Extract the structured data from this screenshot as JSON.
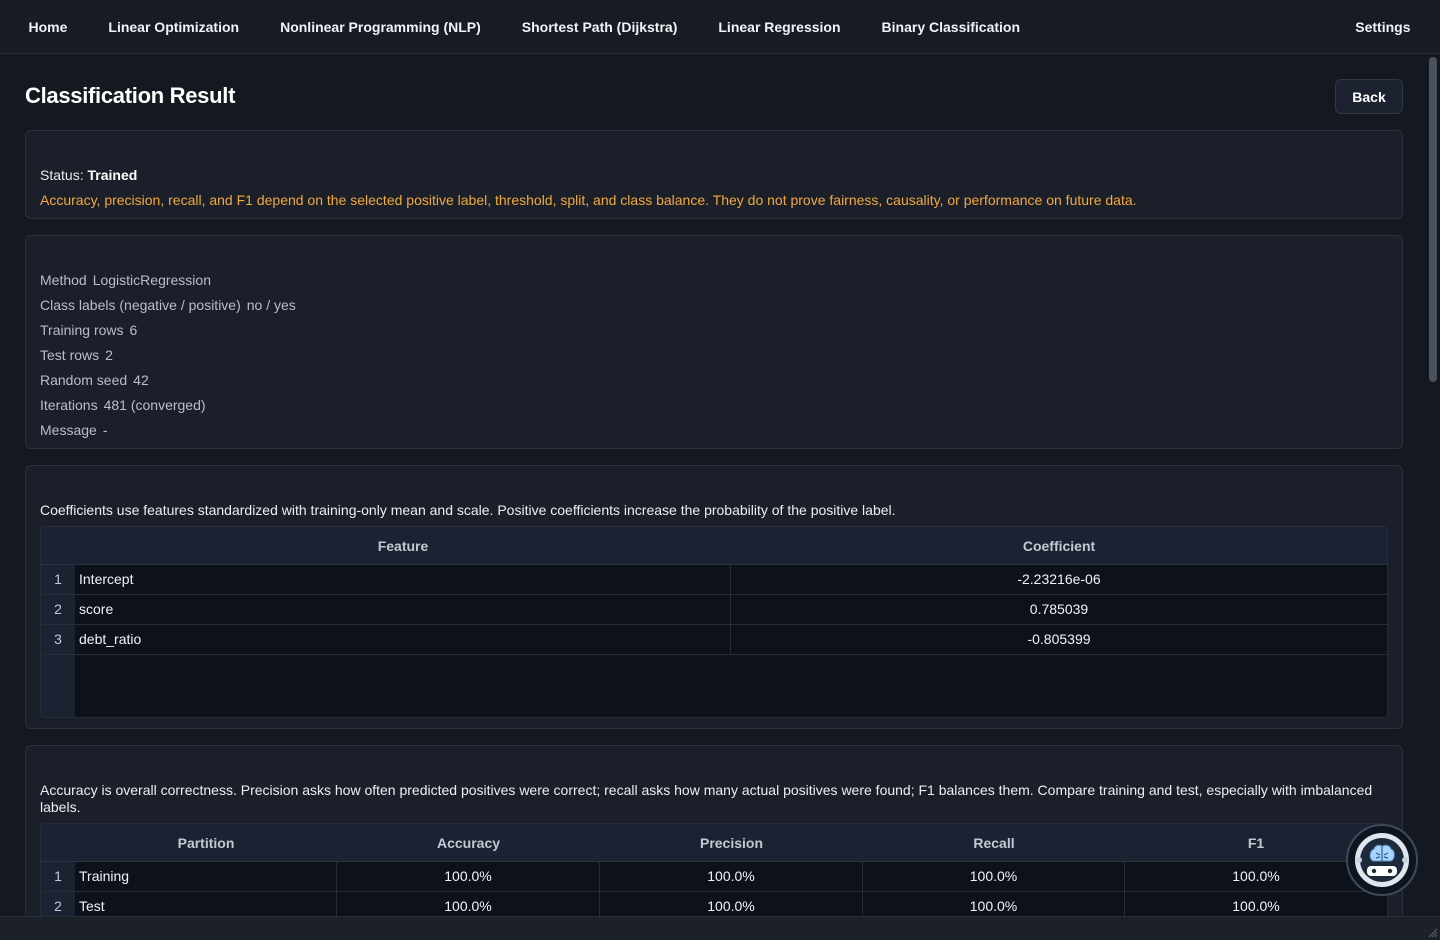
{
  "nav": {
    "items": [
      {
        "label": "Home"
      },
      {
        "label": "Linear Optimization"
      },
      {
        "label": "Nonlinear Programming (NLP)"
      },
      {
        "label": "Shortest Path (Dijkstra)"
      },
      {
        "label": "Linear Regression"
      },
      {
        "label": "Binary Classification"
      }
    ],
    "settings_label": "Settings"
  },
  "page": {
    "title": "Classification Result",
    "back_label": "Back"
  },
  "status": {
    "prefix": "Status:",
    "value": "Trained",
    "warning": "Accuracy, precision, recall, and F1 depend on the selected positive label, threshold, split, and class balance. They do not prove fairness, causality, or performance on future data."
  },
  "info": [
    {
      "label": "Method",
      "value": "LogisticRegression"
    },
    {
      "label": "Class labels (negative / positive)",
      "value": "no / yes"
    },
    {
      "label": "Training rows",
      "value": "6"
    },
    {
      "label": "Test rows",
      "value": "2"
    },
    {
      "label": "Random seed",
      "value": "42"
    },
    {
      "label": "Iterations",
      "value": "481 (converged)"
    },
    {
      "label": "Message",
      "value": "-"
    }
  ],
  "coefficients": {
    "note": "Coefficients use features standardized with training-only mean and scale. Positive coefficients increase the probability of the positive label.",
    "headers": [
      "Feature",
      "Coefficient"
    ],
    "rows": [
      {
        "n": "1",
        "feature": "Intercept",
        "coef": "-2.23216e-06"
      },
      {
        "n": "2",
        "feature": "score",
        "coef": "0.785039"
      },
      {
        "n": "3",
        "feature": "debt_ratio",
        "coef": "-0.805399"
      }
    ]
  },
  "metrics": {
    "note": "Accuracy is overall correctness. Precision asks how often predicted positives were correct; recall asks how many actual positives were found; F1 balances them. Compare training and test, especially with imbalanced labels.",
    "headers": [
      "Partition",
      "Accuracy",
      "Precision",
      "Recall",
      "F1"
    ],
    "rows": [
      {
        "n": "1",
        "partition": "Training",
        "accuracy": "100.0%",
        "precision": "100.0%",
        "recall": "100.0%",
        "f1": "100.0%"
      },
      {
        "n": "2",
        "partition": "Test",
        "accuracy": "100.0%",
        "precision": "100.0%",
        "recall": "100.0%",
        "f1": "100.0%"
      }
    ]
  },
  "icons": {
    "assistant": "robot-brain-icon"
  },
  "colors": {
    "background": "#141820",
    "warning": "#f2a93b",
    "card": "#1a1f2a"
  }
}
